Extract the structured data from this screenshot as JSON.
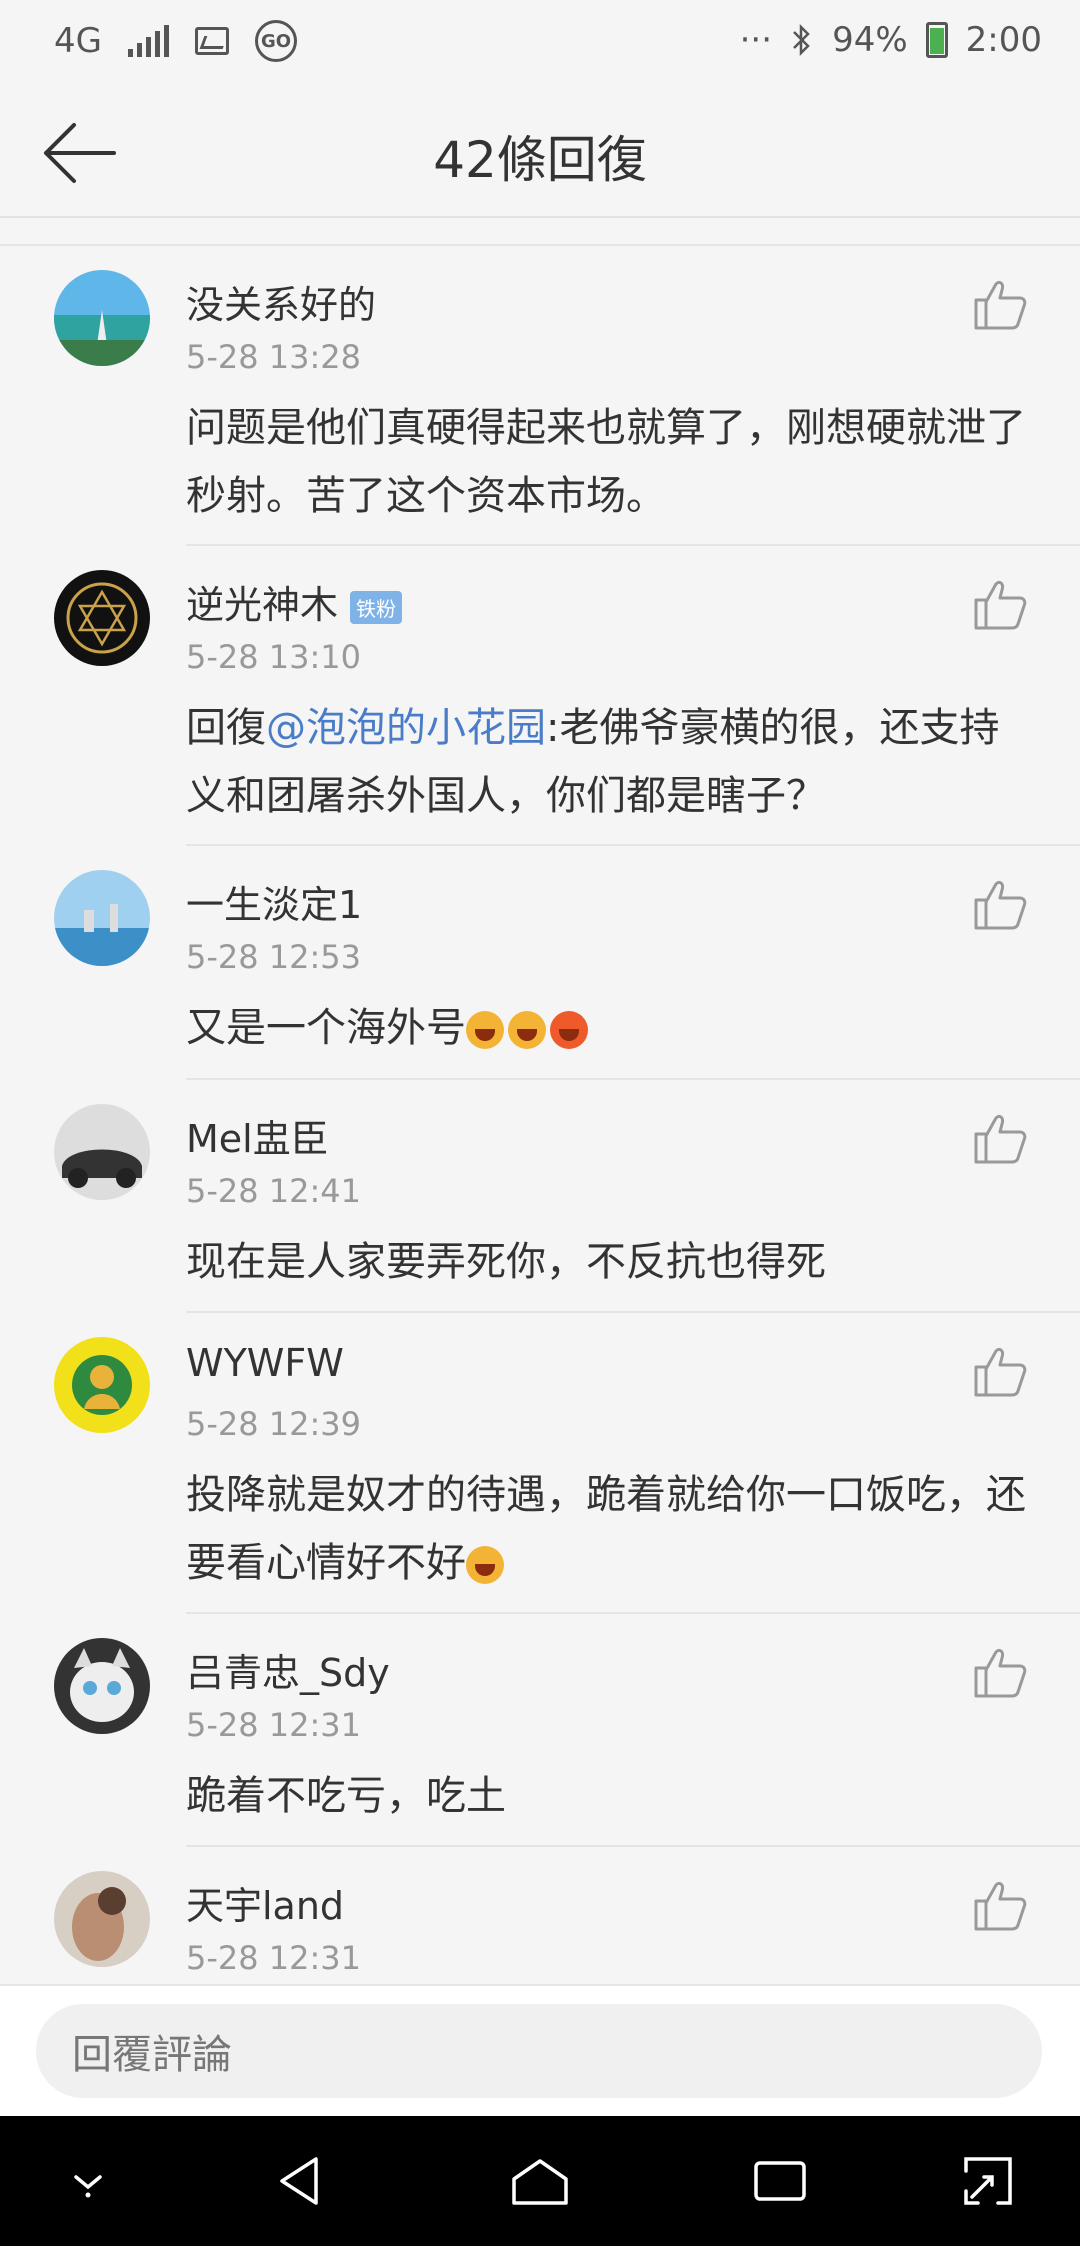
{
  "status_bar": {
    "network": "4G",
    "go_label": "GO",
    "dots": "···",
    "battery_percent": "94%",
    "time": "2:00",
    "battery_color": "#4cb050"
  },
  "header": {
    "title": "42條回復",
    "back_icon": "arrow-left-icon"
  },
  "comments": [
    {
      "user": "没关系好的",
      "time": "5-28 13:28",
      "content": "问题是他们真硬得起来也就算了，刚想硬就泄了秒射。苦了这个资本市场。"
    },
    {
      "user": "逆光神木",
      "badge": "铁粉",
      "time": "5-28 13:10",
      "content_prefix": "回復",
      "mention": "@泡泡的小花园",
      "content": ":老佛爷豪横的很，还支持义和团屠杀外国人，你们都是瞎子？"
    },
    {
      "user": "一生淡定1",
      "time": "5-28 12:53",
      "content": "又是一个海外号"
    },
    {
      "user": "Mel盅臣",
      "time": "5-28 12:41",
      "content": "现在是人家要弄死你，不反抗也得死"
    },
    {
      "user": "WYWFW",
      "time": "5-28 12:39",
      "content": "投降就是奴才的待遇，跪着就给你一口饭吃，还要看心情好不好"
    },
    {
      "user": "吕青忠_Sdy",
      "time": "5-28 12:31",
      "content": "跪着不吃亏，吃土"
    },
    {
      "user": "天宇land",
      "time": "5-28 12:31",
      "content": ""
    }
  ],
  "reply_bar": {
    "placeholder": "回覆評論"
  },
  "nav_bar": {
    "icons": [
      "chevron-down-icon",
      "back-triangle-icon",
      "home-icon",
      "recents-icon",
      "expand-icon"
    ]
  },
  "colors": {
    "mention": "#4a7cc7",
    "badge": "#7fb3e8",
    "background": "#f5f5f5"
  }
}
